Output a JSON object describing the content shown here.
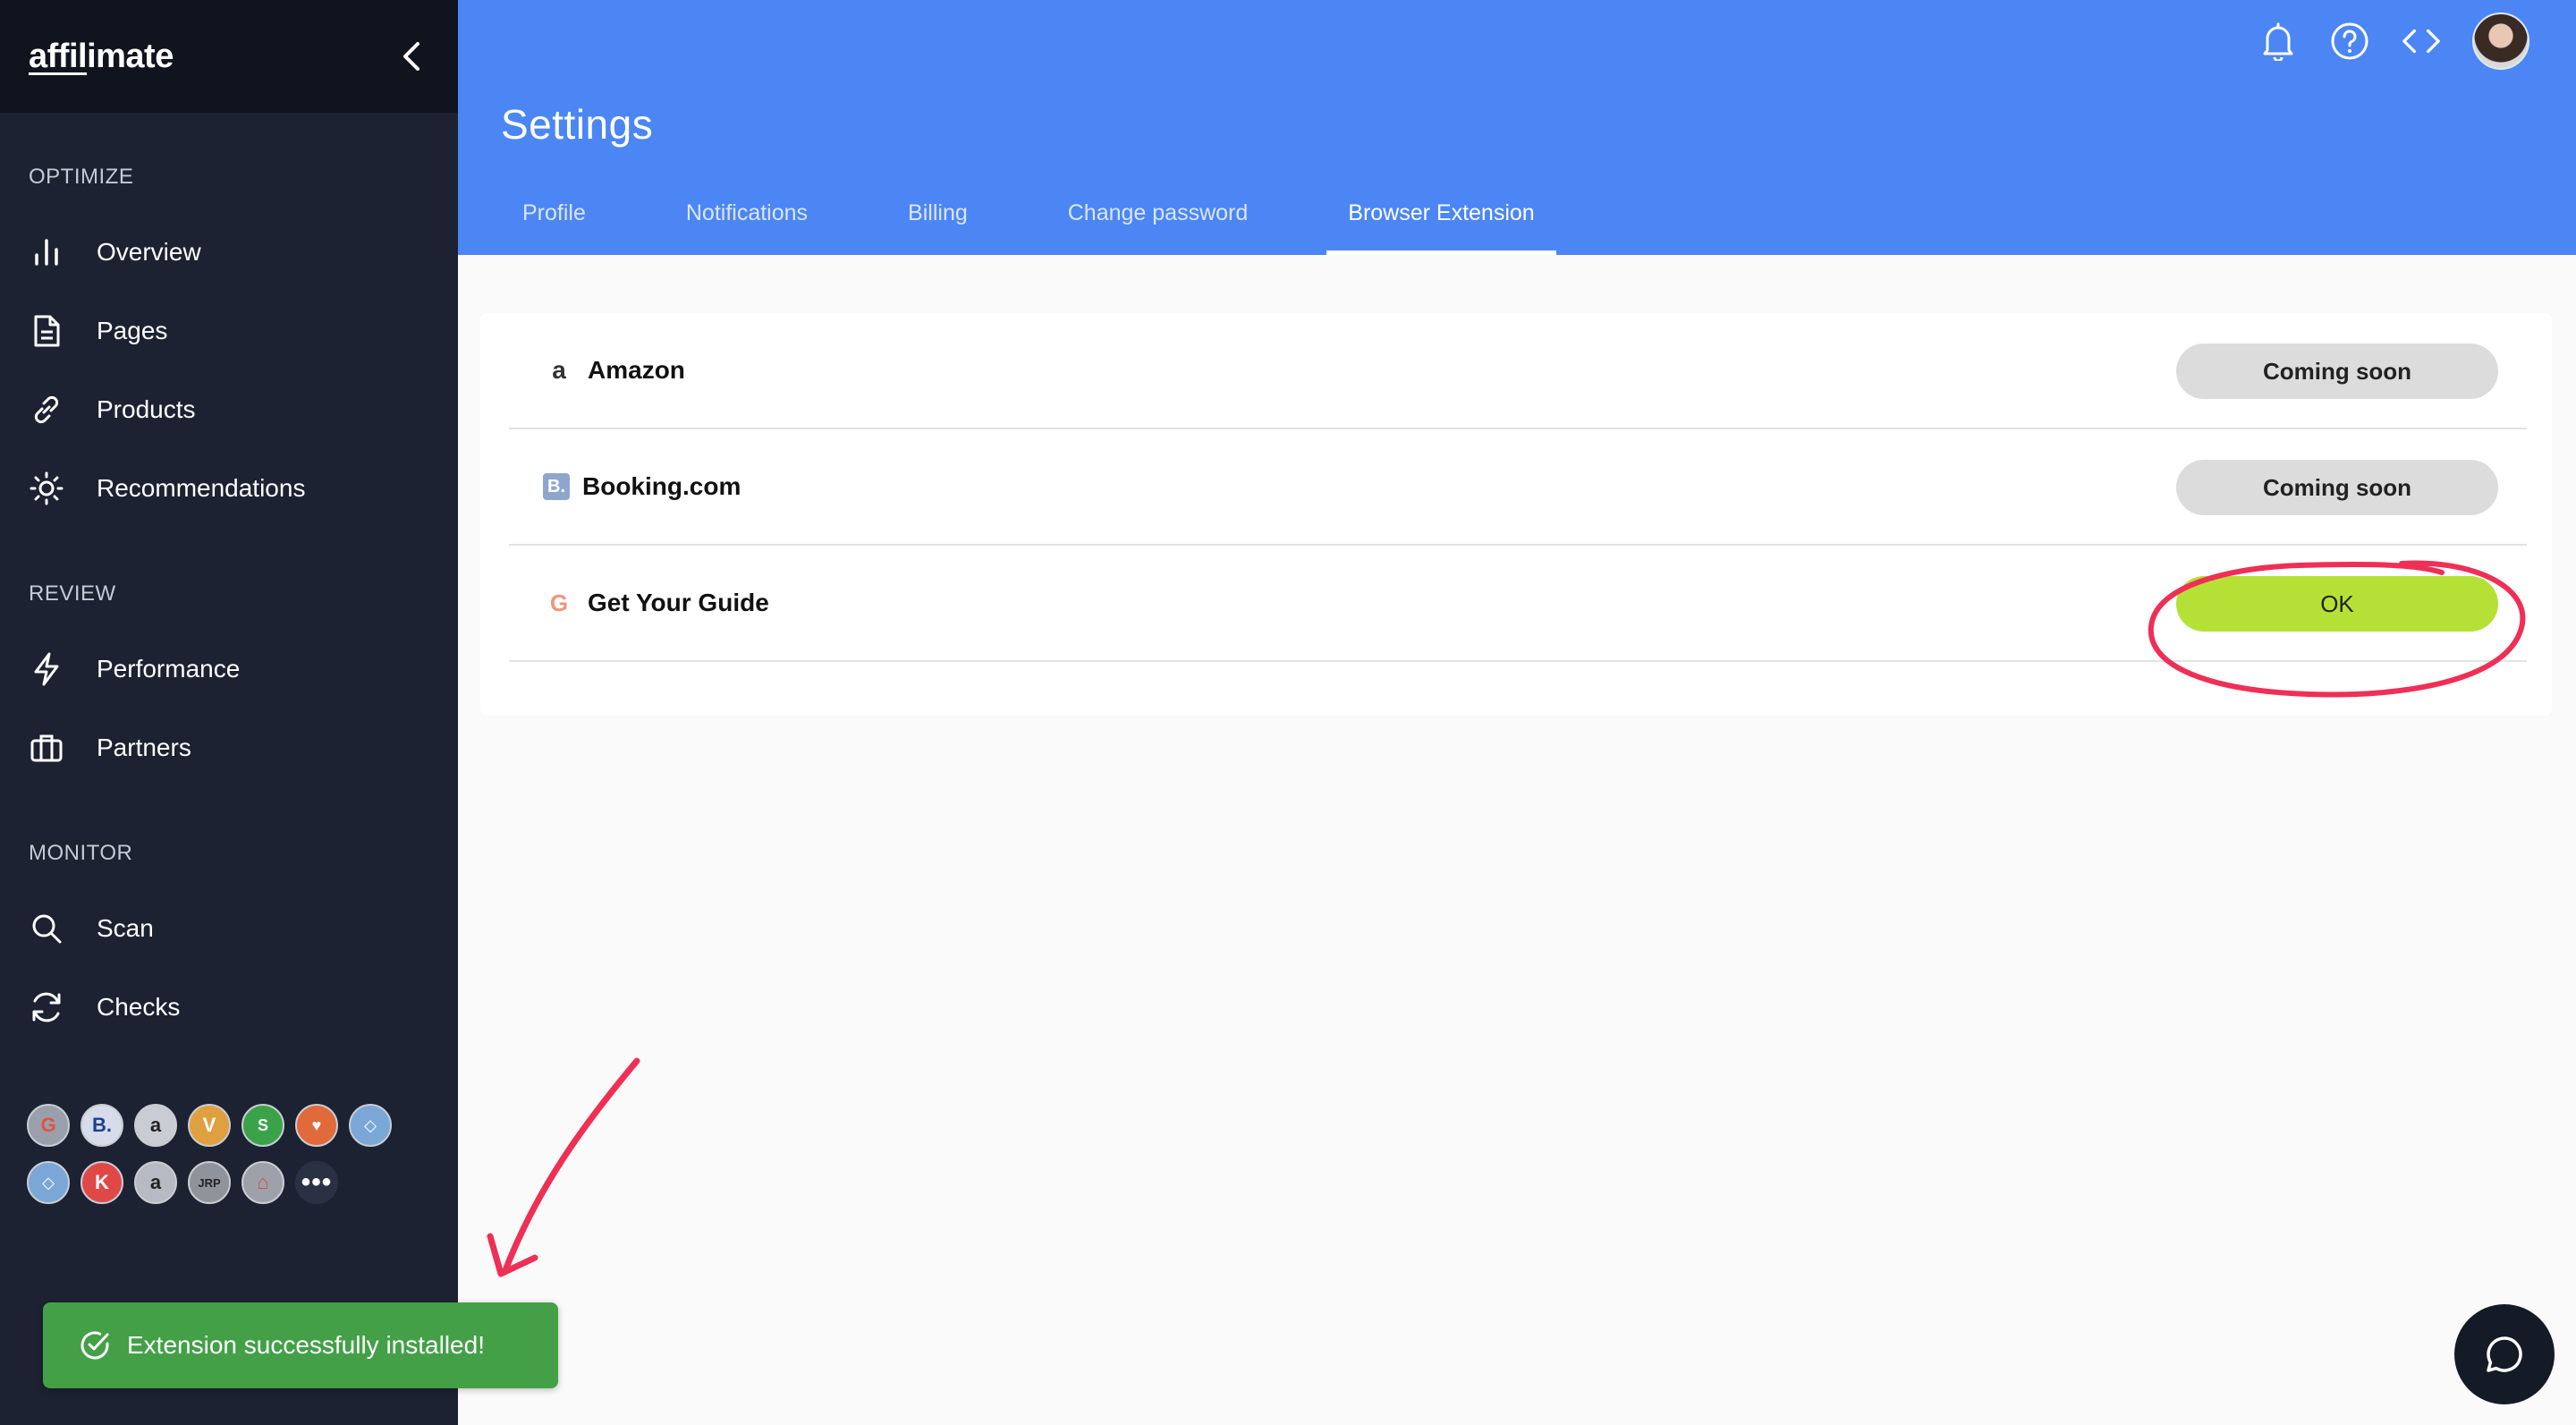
{
  "sidebar": {
    "logo": {
      "part1": "affil",
      "part2": "imate"
    },
    "sections": [
      {
        "label": "OPTIMIZE",
        "items": [
          {
            "label": "Overview",
            "icon": "bar-chart-icon"
          },
          {
            "label": "Pages",
            "icon": "document-icon"
          },
          {
            "label": "Products",
            "icon": "link-icon"
          },
          {
            "label": "Recommendations",
            "icon": "sun-icon"
          }
        ]
      },
      {
        "label": "REVIEW",
        "items": [
          {
            "label": "Performance",
            "icon": "lightning-icon"
          },
          {
            "label": "Partners",
            "icon": "briefcase-icon"
          }
        ]
      },
      {
        "label": "MONITOR",
        "items": [
          {
            "label": "Scan",
            "icon": "search-icon"
          },
          {
            "label": "Checks",
            "icon": "refresh-icon"
          }
        ]
      }
    ],
    "partner_badges": [
      [
        "G",
        "B.",
        "a",
        "V",
        "S",
        "♥",
        "◇"
      ],
      [
        "◇",
        "K",
        "a",
        "JRP",
        "⌂",
        "•••"
      ]
    ]
  },
  "header": {
    "title": "Settings",
    "tabs": [
      "Profile",
      "Notifications",
      "Billing",
      "Change password",
      "Browser Extension"
    ],
    "active_tab": "Browser Extension"
  },
  "extensions": [
    {
      "name": "Amazon",
      "logo": "a",
      "button": "Coming soon",
      "status": "coming-soon"
    },
    {
      "name": "Booking.com",
      "logo": "B.",
      "button": "Coming soon",
      "status": "coming-soon"
    },
    {
      "name": "Get Your Guide",
      "logo": "G",
      "button": "OK",
      "status": "ok"
    }
  ],
  "toast": {
    "message": "Extension successfully installed!"
  },
  "colors": {
    "header": "#4b86f4",
    "sidebar": "#1c2232",
    "ok_button": "#b5e137",
    "toast": "#43a047",
    "annotation": "#ef2f55"
  }
}
